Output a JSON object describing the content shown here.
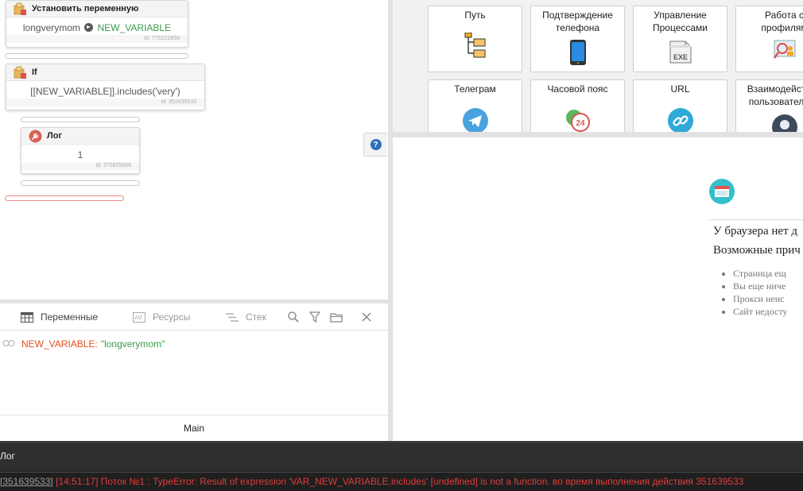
{
  "canvas": {
    "nodes": [
      {
        "title": "Установить переменную",
        "value_left": "longverymom",
        "value_right": "NEW_VARIABLE",
        "id": "Id: 775222858"
      },
      {
        "title": "If",
        "value": "[[NEW_VARIABLE]].includes('very')",
        "id": "Id: 351639533"
      },
      {
        "title": "Лог",
        "value": "1",
        "id": "Id: 375825968"
      }
    ],
    "help_label": "?"
  },
  "variables_panel": {
    "tabs": [
      {
        "label": "Переменные",
        "active": true,
        "icon": "table-icon"
      },
      {
        "label": "Ресурсы",
        "active": false,
        "icon": "resources-icon"
      },
      {
        "label": "Стек",
        "active": false,
        "icon": "stack-icon"
      }
    ],
    "tools": [
      "search-icon",
      "filter-icon",
      "folder-icon",
      "close-icon"
    ],
    "rows": [
      {
        "name": "NEW_VARIABLE:",
        "value": "\"longverymom\""
      }
    ],
    "thread_tab": "Main"
  },
  "actions_grid": {
    "tiles": [
      {
        "label": "Путь",
        "icon": "folder-tree-icon"
      },
      {
        "label": "Подтверждение телефона",
        "icon": "smartphone-icon"
      },
      {
        "label": "Управление Процессами",
        "icon": "exe-file-icon"
      },
      {
        "label": "Работа с профилям",
        "icon": "profile-search-icon"
      },
      {
        "label": "Телеграм",
        "icon": "telegram-icon"
      },
      {
        "label": "Часовой пояс",
        "icon": "timezone-24-icon"
      },
      {
        "label": "URL",
        "icon": "link-icon"
      },
      {
        "label": "Взаимодейст пользовател",
        "icon": "user-icon"
      }
    ]
  },
  "browser": {
    "heading": "У браузера нет д",
    "subheading": "Возможные прич",
    "reasons": [
      "Страница ещ",
      "Вы еще ниче",
      "Прокси неис",
      "Сайт недосту"
    ]
  },
  "log": {
    "title": "Лог",
    "entry_id": "[351639533]",
    "entry_text": " [14:51:17] Поток №1 : TypeError: Result of expression 'VAR_NEW_VARIABLE.includes' [undefined] is not a function. во время выполнения действия 351639533",
    "colors": {
      "error": "#e23b3b",
      "background": "#2b2b2b"
    }
  }
}
